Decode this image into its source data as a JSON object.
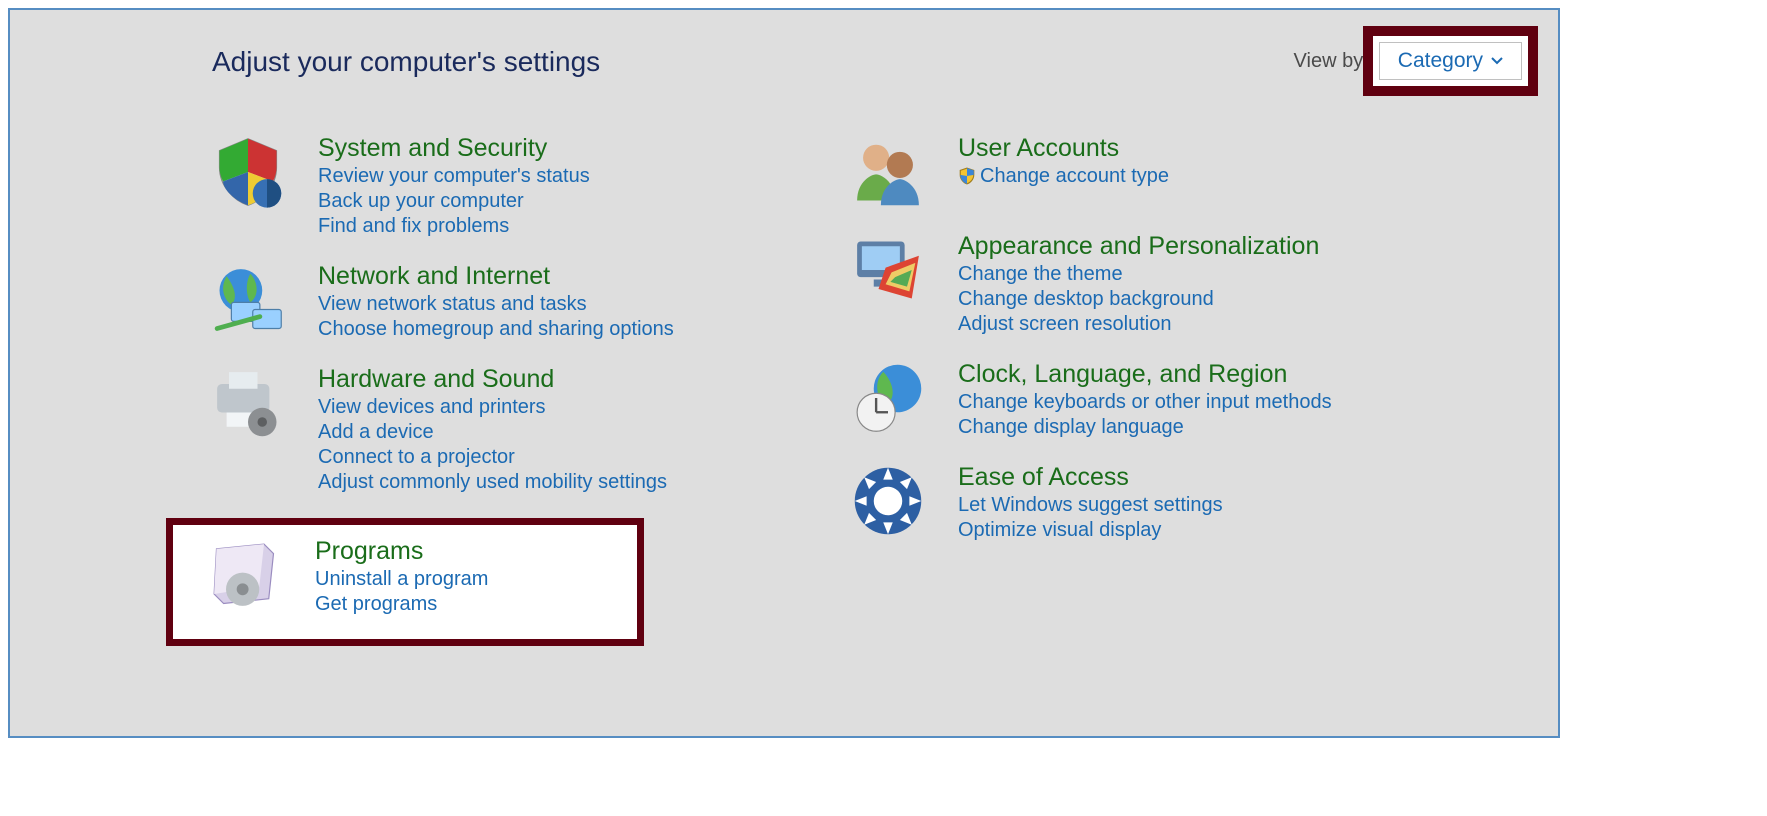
{
  "header": {
    "title": "Adjust your computer's settings",
    "viewby_label": "View by:",
    "viewby_selected": "Category"
  },
  "left": [
    {
      "icon": "security-shield",
      "title": "System and Security",
      "links": [
        "Review your computer's status",
        "Back up your computer",
        "Find and fix problems"
      ]
    },
    {
      "icon": "network-globe",
      "title": "Network and Internet",
      "links": [
        "View network status and tasks",
        "Choose homegroup and sharing options"
      ]
    },
    {
      "icon": "hardware-printer",
      "title": "Hardware and Sound",
      "links": [
        "View devices and printers",
        "Add a device",
        "Connect to a projector",
        "Adjust commonly used mobility settings"
      ]
    }
  ],
  "programs": {
    "icon": "programs-box",
    "title": "Programs",
    "links": [
      "Uninstall a program",
      "Get programs"
    ]
  },
  "right": [
    {
      "icon": "users",
      "title": "User Accounts",
      "links": [
        "Change account type"
      ],
      "shield_on": 0
    },
    {
      "icon": "appearance",
      "title": "Appearance and Personalization",
      "links": [
        "Change the theme",
        "Change desktop background",
        "Adjust screen resolution"
      ]
    },
    {
      "icon": "clock-globe",
      "title": "Clock, Language, and Region",
      "links": [
        "Change keyboards or other input methods",
        "Change display language"
      ]
    },
    {
      "icon": "ease-access",
      "title": "Ease of Access",
      "links": [
        "Let Windows suggest settings",
        "Optimize visual display"
      ]
    }
  ]
}
